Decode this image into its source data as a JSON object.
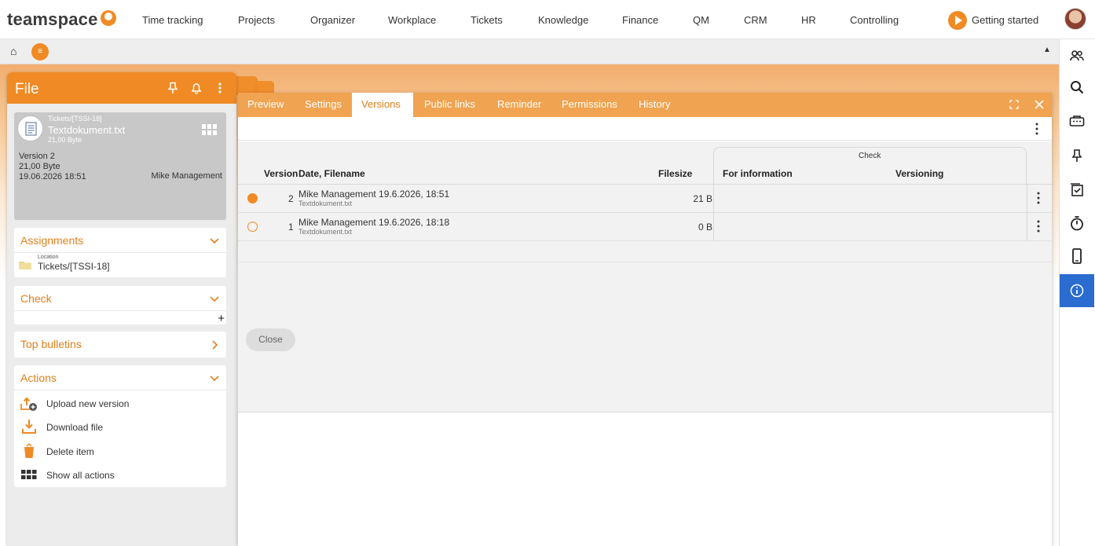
{
  "app": {
    "logo": "teamspace"
  },
  "topnav": {
    "items": [
      "Time tracking",
      "Projects",
      "Organizer",
      "Workplace",
      "Tickets",
      "Knowledge",
      "Finance",
      "QM",
      "CRM",
      "HR",
      "Controlling"
    ],
    "getting_started": "Getting started"
  },
  "subbar": {
    "menu_symbol": "≡"
  },
  "file_panel": {
    "title": "File",
    "card": {
      "path": "Tickets/[TSSI-18]",
      "name": "Textdokument.txt",
      "size": "21,00 Byte",
      "version": "Version 2",
      "size_detail": "21,00 Byte",
      "datetime": "19.06.2026 18:51",
      "user": "Mike Management"
    },
    "assignments": {
      "title": "Assignments",
      "location_label": "Location",
      "location_value": "Tickets/[TSSI-18]"
    },
    "check": {
      "title": "Check",
      "add_symbol": "+"
    },
    "top_bulletins": {
      "title": "Top bulletins"
    },
    "actions": {
      "title": "Actions",
      "items": [
        "Upload new version",
        "Download file",
        "Delete item",
        "Show all actions"
      ]
    }
  },
  "dialog": {
    "tabs": [
      "Preview",
      "Settings",
      "Versions",
      "Public links",
      "Reminder",
      "Permissions",
      "History"
    ],
    "active_tab": "Versions",
    "table": {
      "group_header": "Check",
      "headers": {
        "version": "Version",
        "date_filename": "Date, Filename",
        "filesize": "Filesize",
        "for_information": "For information",
        "versioning": "Versioning"
      },
      "rows": [
        {
          "selected": true,
          "version": "2",
          "title": "Mike Management 19.6.2026, 18:51",
          "filename": "Textdokument.txt",
          "filesize": "21 B"
        },
        {
          "selected": false,
          "version": "1",
          "title": "Mike Management 19.6.2026, 18:18",
          "filename": "Textdokument.txt",
          "filesize": "0 B"
        }
      ]
    },
    "close_label": "Close"
  },
  "colors": {
    "accent": "#f08a24",
    "tab_bar": "#f0a350",
    "active_sidebar": "#2a6ccf"
  }
}
